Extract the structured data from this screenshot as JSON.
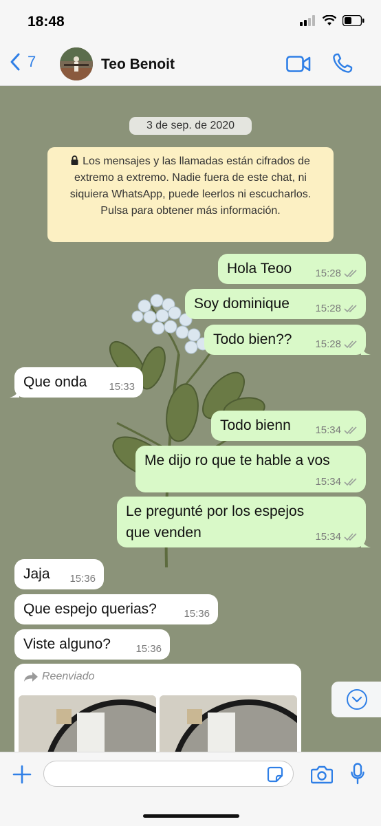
{
  "status_bar": {
    "time": "18:48"
  },
  "header": {
    "back_count": "7",
    "contact_name": "Teo Benoit"
  },
  "chat": {
    "date": "3 de sep. de 2020",
    "encryption_notice": "Los mensajes y las llamadas están cifrados de extremo a extremo. Nadie fuera de este chat, ni siquiera WhatsApp, puede leerlos ni escucharlos. Pulsa para obtener más información.",
    "messages": [
      {
        "dir": "out",
        "text": "Hola Teoo",
        "time": "15:28"
      },
      {
        "dir": "out",
        "text": "Soy dominique",
        "time": "15:28"
      },
      {
        "dir": "out",
        "text": "Todo bien??",
        "time": "15:28"
      },
      {
        "dir": "in",
        "text": "Que onda",
        "time": "15:33"
      },
      {
        "dir": "out",
        "text": "Todo bienn",
        "time": "15:34"
      },
      {
        "dir": "out",
        "text": "Me dijo ro que te hable a vos",
        "time": "15:34"
      },
      {
        "dir": "out",
        "text": "Le pregunté por los espejos que venden",
        "time": "15:34"
      },
      {
        "dir": "in",
        "text": "Jaja",
        "time": "15:36"
      },
      {
        "dir": "in",
        "text": "Que espejo querias?",
        "time": "15:36"
      },
      {
        "dir": "in",
        "text": "Viste alguno?",
        "time": "15:36"
      }
    ],
    "forwarded_label": "Reenviado"
  },
  "composer": {
    "placeholder": ""
  },
  "colors": {
    "accent": "#2f7fe6",
    "outgoing_bubble": "#d9f9c8",
    "chat_background": "#8b9379"
  }
}
